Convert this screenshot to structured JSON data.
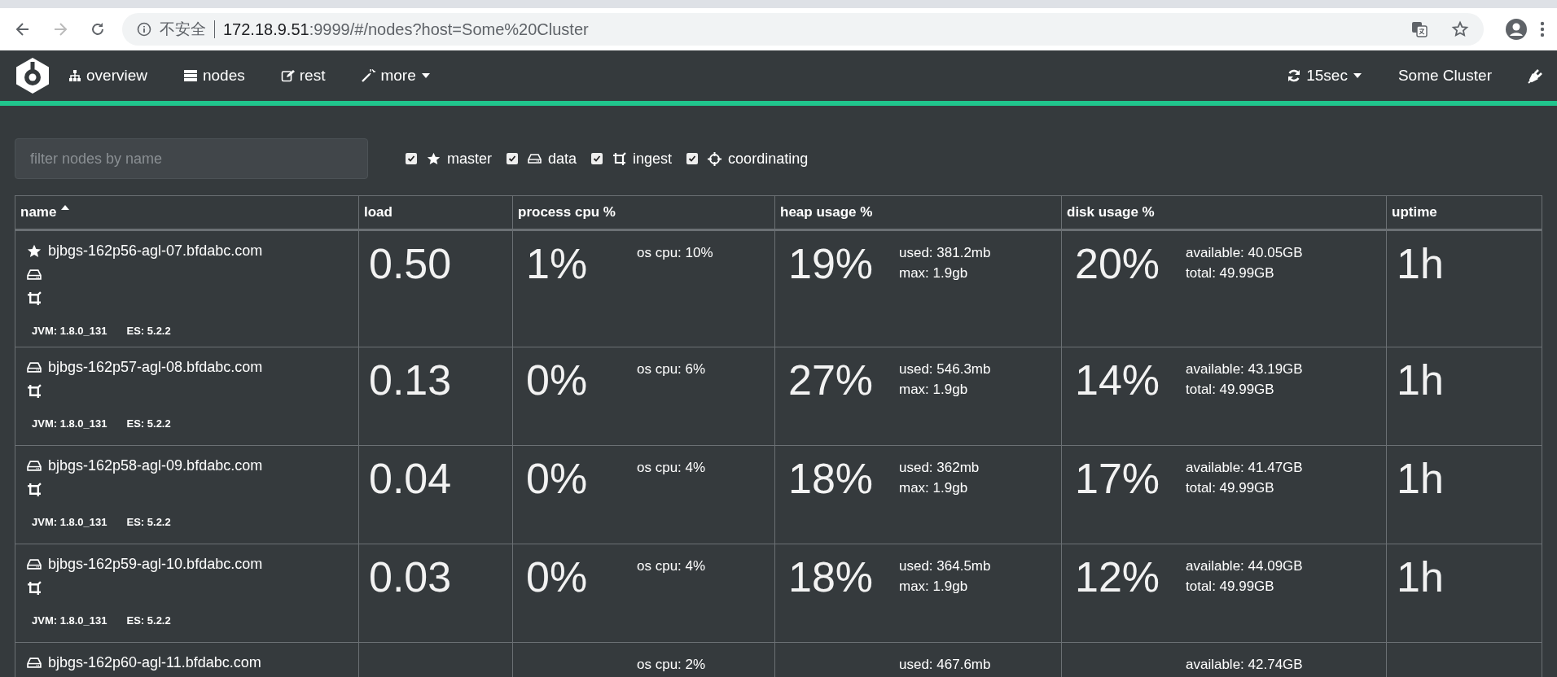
{
  "browser": {
    "security": "不安全",
    "url_host": "172.18.9.51",
    "url_rest": ":9999/#/nodes?host=Some%20Cluster"
  },
  "navbar": {
    "items": [
      {
        "kind": "overview",
        "label": "overview"
      },
      {
        "kind": "nodes",
        "label": "nodes"
      },
      {
        "kind": "rest",
        "label": "rest"
      },
      {
        "kind": "more",
        "label": "more"
      }
    ],
    "refresh": "15sec",
    "cluster": "Some Cluster"
  },
  "filter": {
    "placeholder": "filter nodes by name",
    "roles": [
      {
        "kind": "master",
        "label": "master",
        "checked": true
      },
      {
        "kind": "data",
        "label": "data",
        "checked": true
      },
      {
        "kind": "ingest",
        "label": "ingest",
        "checked": true
      },
      {
        "kind": "coordinating",
        "label": "coordinating",
        "checked": true
      }
    ]
  },
  "table": {
    "columns": [
      {
        "label": "name",
        "sorted": true
      },
      {
        "label": "load",
        "sorted": false
      },
      {
        "label": "process cpu %",
        "sorted": false
      },
      {
        "label": "heap usage %",
        "sorted": false
      },
      {
        "label": "disk usage %",
        "sorted": false
      },
      {
        "label": "uptime",
        "sorted": false
      }
    ],
    "rows": [
      {
        "roles": [
          {
            "kind": "master"
          },
          {
            "kind": "data"
          },
          {
            "kind": "ingest"
          }
        ],
        "name": "bjbgs-162p56-agl-07.bfdabc.com",
        "jvm": "JVM: 1.8.0_131",
        "es": "ES: 5.2.2",
        "load": "0.50",
        "cpu": "1%",
        "os_cpu": "os cpu: 10%",
        "heap": "19%",
        "heap_used": "used: 381.2mb",
        "heap_max": "max: 1.9gb",
        "disk": "20%",
        "disk_available": "available: 40.05GB",
        "disk_total": "total: 49.99GB",
        "uptime": "1h"
      },
      {
        "roles": [
          {
            "kind": "data"
          },
          {
            "kind": "ingest"
          }
        ],
        "name": "bjbgs-162p57-agl-08.bfdabc.com",
        "jvm": "JVM: 1.8.0_131",
        "es": "ES: 5.2.2",
        "load": "0.13",
        "cpu": "0%",
        "os_cpu": "os cpu: 6%",
        "heap": "27%",
        "heap_used": "used: 546.3mb",
        "heap_max": "max: 1.9gb",
        "disk": "14%",
        "disk_available": "available: 43.19GB",
        "disk_total": "total: 49.99GB",
        "uptime": "1h"
      },
      {
        "roles": [
          {
            "kind": "data"
          },
          {
            "kind": "ingest"
          }
        ],
        "name": "bjbgs-162p58-agl-09.bfdabc.com",
        "jvm": "JVM: 1.8.0_131",
        "es": "ES: 5.2.2",
        "load": "0.04",
        "cpu": "0%",
        "os_cpu": "os cpu: 4%",
        "heap": "18%",
        "heap_used": "used: 362mb",
        "heap_max": "max: 1.9gb",
        "disk": "17%",
        "disk_available": "available: 41.47GB",
        "disk_total": "total: 49.99GB",
        "uptime": "1h"
      },
      {
        "roles": [
          {
            "kind": "data"
          },
          {
            "kind": "ingest"
          }
        ],
        "name": "bjbgs-162p59-agl-10.bfdabc.com",
        "jvm": "JVM: 1.8.0_131",
        "es": "ES: 5.2.2",
        "load": "0.03",
        "cpu": "0%",
        "os_cpu": "os cpu: 4%",
        "heap": "18%",
        "heap_used": "used: 364.5mb",
        "heap_max": "max: 1.9gb",
        "disk": "12%",
        "disk_available": "available: 44.09GB",
        "disk_total": "total: 49.99GB",
        "uptime": "1h"
      },
      {
        "roles": [
          {
            "kind": "data"
          }
        ],
        "name": "bjbgs-162p60-agl-11.bfdabc.com",
        "os_cpu": "os cpu: 2%",
        "heap_used": "used: 467.6mb",
        "disk_available": "available: 42.74GB"
      }
    ]
  }
}
